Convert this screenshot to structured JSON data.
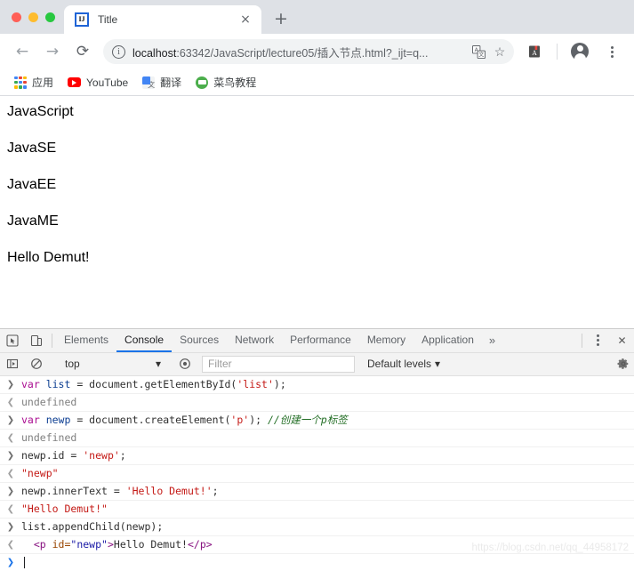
{
  "window": {
    "traffic_lights": [
      "close",
      "minimize",
      "maximize"
    ],
    "colors": {
      "close": "#ff5f57",
      "minimize": "#febc2e",
      "maximize": "#28c840",
      "accent": "#1a73e8",
      "chrome_bg": "#dee1e6"
    }
  },
  "tab": {
    "title": "Title",
    "favicon_label": "IJ",
    "close_label": "×",
    "new_tab_label": "+"
  },
  "nav": {
    "back": "←",
    "forward": "→",
    "reload": "⟳",
    "info_label": "i"
  },
  "omnibox": {
    "url_host": "localhost",
    "url_rest": ":63342/JavaScript/lecture05/插入节点.html?_ijt=q...",
    "url_full": "localhost:63342/JavaScript/lecture05/插入节点.html?_ijt=q...",
    "translate_title": "translate-icon",
    "star_label": "☆"
  },
  "bookmarks": [
    {
      "label": "应用",
      "icon": "apps-grid-icon"
    },
    {
      "label": "YouTube",
      "icon": "youtube-icon"
    },
    {
      "label": "翻译",
      "icon": "google-translate-icon"
    },
    {
      "label": "菜鸟教程",
      "icon": "runoob-icon"
    }
  ],
  "page": {
    "paragraphs": [
      "JavaScript",
      "JavaSE",
      "JavaEE",
      "JavaME",
      "Hello Demut!"
    ]
  },
  "devtools": {
    "tabs": [
      {
        "label": "Elements",
        "active": false
      },
      {
        "label": "Console",
        "active": true
      },
      {
        "label": "Sources",
        "active": false
      },
      {
        "label": "Network",
        "active": false
      },
      {
        "label": "Performance",
        "active": false
      },
      {
        "label": "Memory",
        "active": false
      },
      {
        "label": "Application",
        "active": false
      }
    ],
    "more_label": "»",
    "close_label": "✕",
    "toolbar": {
      "context": "top",
      "context_caret": "▾",
      "filter_placeholder": "Filter",
      "levels_label": "Default levels",
      "levels_caret": "▾"
    },
    "console_rows": [
      {
        "kind": "input",
        "gutter": "❯",
        "tokens": [
          {
            "t": "var ",
            "c": "kw"
          },
          {
            "t": "list",
            "c": "ident"
          },
          {
            "t": " = document.getElementById(",
            "c": "plain"
          },
          {
            "t": "'list'",
            "c": "str"
          },
          {
            "t": ");",
            "c": "plain"
          }
        ]
      },
      {
        "kind": "output",
        "gutter": "❮",
        "tokens": [
          {
            "t": "undefined",
            "c": "undef"
          }
        ]
      },
      {
        "kind": "input",
        "gutter": "❯",
        "tokens": [
          {
            "t": "var ",
            "c": "kw"
          },
          {
            "t": "newp",
            "c": "ident"
          },
          {
            "t": " = document.createElement(",
            "c": "plain"
          },
          {
            "t": "'p'",
            "c": "str"
          },
          {
            "t": "); ",
            "c": "plain"
          },
          {
            "t": "//创建一个p标签",
            "c": "cmt"
          }
        ]
      },
      {
        "kind": "output",
        "gutter": "❮",
        "tokens": [
          {
            "t": "undefined",
            "c": "undef"
          }
        ]
      },
      {
        "kind": "input",
        "gutter": "❯",
        "tokens": [
          {
            "t": "newp.id = ",
            "c": "plain"
          },
          {
            "t": "'newp'",
            "c": "str"
          },
          {
            "t": ";",
            "c": "plain"
          }
        ]
      },
      {
        "kind": "output",
        "gutter": "❮",
        "tokens": [
          {
            "t": "\"newp\"",
            "c": "strout"
          }
        ]
      },
      {
        "kind": "input",
        "gutter": "❯",
        "tokens": [
          {
            "t": "newp.innerText = ",
            "c": "plain"
          },
          {
            "t": "'Hello Demut!'",
            "c": "str"
          },
          {
            "t": ";",
            "c": "plain"
          }
        ]
      },
      {
        "kind": "output",
        "gutter": "❮",
        "tokens": [
          {
            "t": "\"Hello Demut!\"",
            "c": "strout"
          }
        ]
      },
      {
        "kind": "input",
        "gutter": "❯",
        "tokens": [
          {
            "t": "list.appendChild(newp);",
            "c": "plain"
          }
        ]
      },
      {
        "kind": "output",
        "gutter": "❮",
        "tokens": [
          {
            "t": "  <p",
            "c": "tag"
          },
          {
            "t": " id=",
            "c": "attr"
          },
          {
            "t": "\"newp\"",
            "c": "attrval"
          },
          {
            "t": ">",
            "c": "tag"
          },
          {
            "t": "Hello Demut!",
            "c": "txt"
          },
          {
            "t": "</p>",
            "c": "tag"
          }
        ]
      },
      {
        "kind": "prompt",
        "gutter": "❯",
        "tokens": []
      }
    ]
  },
  "watermark": "https://blog.csdn.net/qq_44958172"
}
